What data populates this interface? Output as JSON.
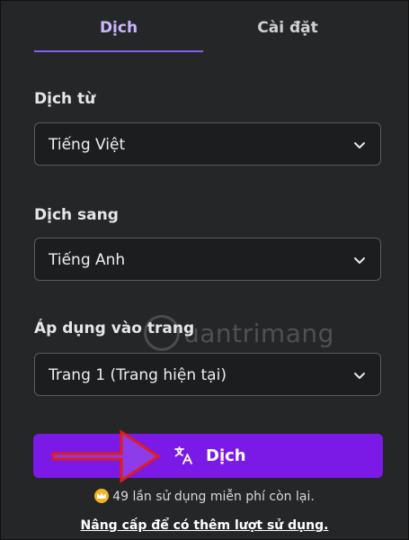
{
  "tabs": [
    {
      "label": "Dịch",
      "active": true
    },
    {
      "label": "Cài đặt",
      "active": false
    }
  ],
  "form": {
    "from_label": "Dịch từ",
    "from_value": "Tiếng Việt",
    "to_label": "Dịch sang",
    "to_value": "Tiếng Anh",
    "apply_label": "Áp dụng vào trang",
    "apply_value": "Trang 1 (Trang hiện tại)"
  },
  "translate_button": {
    "label": "Dịch",
    "icon": "translate-icon"
  },
  "usage_text": "49 lần sử dụng miễn phí còn lại.",
  "upgrade_link": "Nâng cấp để có thêm lượt sử dụng.",
  "watermark": "uantrimang",
  "colors": {
    "background": "#252627",
    "accent": "#8b5cf6",
    "button": "#7b1ae6",
    "arrow": "#e01c1c",
    "crown": "#f2b320"
  }
}
